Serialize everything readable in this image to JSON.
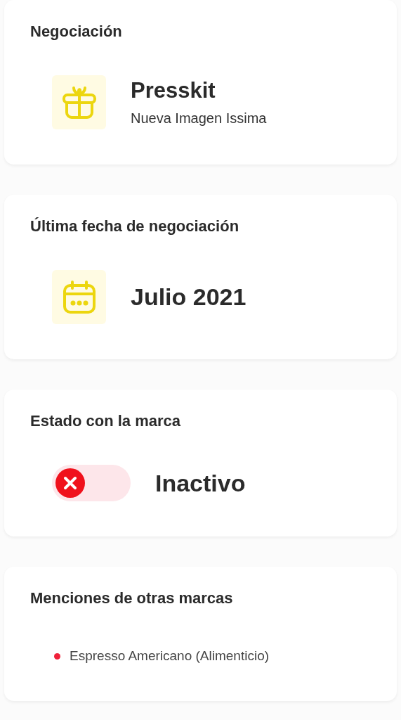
{
  "cards": [
    {
      "kind": "item",
      "title": "Negociación",
      "name": "Presskit",
      "subtitle": "Nueva Imagen Issima"
    },
    {
      "kind": "date",
      "title": "Última fecha de negociación",
      "value": "Julio 2021"
    },
    {
      "kind": "status",
      "title": "Estado con la marca",
      "on": false,
      "value": "Inactivo"
    },
    {
      "kind": "list",
      "title": "Menciones de otras marcas",
      "items": [
        "Espresso Americano (Alimenticio)"
      ]
    }
  ]
}
